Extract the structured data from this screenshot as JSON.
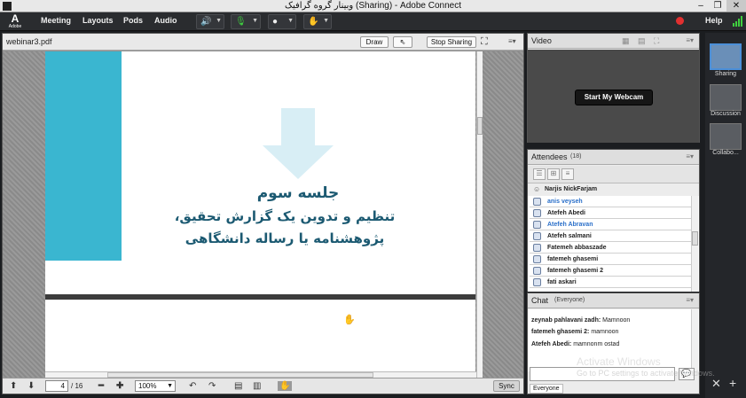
{
  "window": {
    "title": "وبینار گروه گرافیک (Sharing) - Adobe Connect",
    "controls": {
      "minimize": "–",
      "restore": "❐",
      "close": "✕"
    }
  },
  "menubar": {
    "logo_mark": "A",
    "logo_text": "Adobe",
    "items": [
      "Meeting",
      "Layouts",
      "Pods",
      "Audio"
    ],
    "help": "Help",
    "icons": [
      "speaker-icon",
      "microphone-icon",
      "webcam-icon",
      "raise-hand-icon",
      "record-icon",
      "signal-bars-icon"
    ],
    "colors": {
      "speaker": "#3fcf3f",
      "microphone": "#3fcf3f",
      "record": "#e23030",
      "signal": "#3fcf3f"
    }
  },
  "share_pod": {
    "filename": "webinar3.pdf",
    "draw_label": "Draw",
    "stop_sharing_label": "Stop Sharing",
    "slide": {
      "line1": "جلسه سوم",
      "line2": "تنظیم و تدوین یک گزارش تحقیق،",
      "line3": "پژوهشنامه یا رساله دانشگاهی",
      "accent_color": "#3ab6d0",
      "text_color": "#1c5a72"
    },
    "footer": {
      "page_current": "4",
      "page_total": "/ 16",
      "zoom": "100%",
      "sync_label": "Sync"
    }
  },
  "video_pod": {
    "title": "Video",
    "start_webcam_label": "Start My Webcam"
  },
  "attendees_pod": {
    "title": "Attendees",
    "count": "(18)",
    "host": "Narjis NickFarjam",
    "rows": [
      {
        "name": "anis veyseh",
        "color": "#2a6fc9"
      },
      {
        "name": "Atefeh Abedi",
        "color": "#222222"
      },
      {
        "name": "Atefeh Abravan",
        "color": "#2a6fc9"
      },
      {
        "name": "Atefeh salmani",
        "color": "#222222"
      },
      {
        "name": "Fatemeh abbaszade",
        "color": "#222222"
      },
      {
        "name": "fatemeh ghasemi",
        "color": "#222222"
      },
      {
        "name": "fatemeh ghasemi 2",
        "color": "#222222"
      },
      {
        "name": "fati askari",
        "color": "#222222"
      }
    ]
  },
  "chat_pod": {
    "title": "Chat",
    "scope": "(Everyone)",
    "messages": [
      {
        "sender": "zeynab pahlavani zadh:",
        "text": "Mamnoon"
      },
      {
        "sender": "fatemeh ghasemi 2:",
        "text": "mamnoon"
      },
      {
        "sender": "Atefeh Abedi:",
        "text": "mamnonm ostad"
      }
    ],
    "recipient_tab": "Everyone"
  },
  "layouts": [
    {
      "label": "Sharing",
      "selected": true
    },
    {
      "label": "Discussion",
      "selected": false
    },
    {
      "label": "Collabo...",
      "selected": false
    }
  ],
  "watermark": {
    "line1": "Activate Windows",
    "line2": "Go to PC settings to activate Windows."
  }
}
